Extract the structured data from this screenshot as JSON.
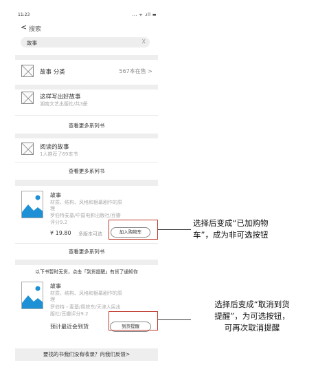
{
  "status": {
    "time": "11:23",
    "icons": "... ᯤ .ıll ▬"
  },
  "nav": {
    "back_icon": "<",
    "title": "搜索"
  },
  "search": {
    "query": "故事",
    "clear": "X"
  },
  "category": {
    "label": "故事 分类",
    "count": "567本在售 >"
  },
  "series1": {
    "title": "这样写出好故事",
    "sub": "湖南文艺出版社/共3册"
  },
  "more_series_1": "查看更多系列书",
  "series2": {
    "title": "阅读的故事",
    "sub": "1人推荐了69本书"
  },
  "more_series_2": "查看更多系列书",
  "book1": {
    "title": "故事",
    "desc_line1": "材质、结构、风格和银幕剧作的原",
    "desc_line2": "理",
    "author_line": "罗伯特麦基/中国电影出版社/豆瓣",
    "rating": "评分9.2",
    "price": "¥ 19.80",
    "versions": "多版本可选",
    "add_cart_label": "加入购物车"
  },
  "more_series_3": "查看更多系列书",
  "oos_notice": "以下书暂时无货，点击「到货提醒」有货了通知你",
  "book2": {
    "title": "故事",
    "desc_line1": "材质、结构、风格和银幕剧作的原",
    "desc_line2": "理",
    "author_line1": "罗伯特・麦基/周铁东/天津人民出",
    "author_line2": "版社/豆瓣评分9.2",
    "eta": "预计最近会到货",
    "notify_label": "到货提醒"
  },
  "feedback": "要找的书我们没有收录？向我们反馈>",
  "annotations": {
    "a1_line1": "选择后变成“已加购物",
    "a1_line2": "车”，成为非可选按钮",
    "a2_line1": "选择后变成“取消到货",
    "a2_line2": "提醒”，为可选按钮，",
    "a2_line3": "可再次取消提醒"
  },
  "colors": {
    "highlight": "#c0392b",
    "cover_blue": "#1e90d6",
    "divider": "#eeeeee"
  }
}
